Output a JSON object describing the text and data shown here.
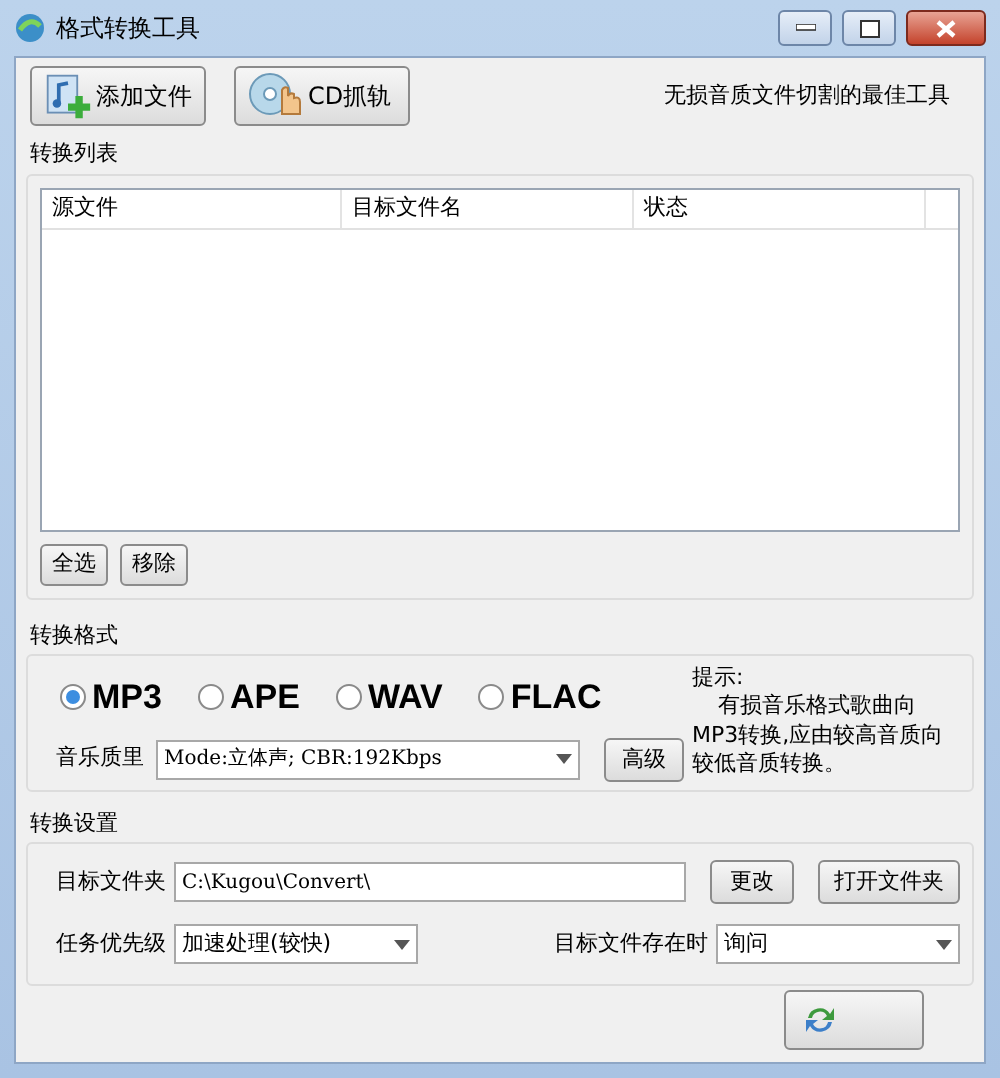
{
  "window": {
    "title": "格式转换工具"
  },
  "toolbar": {
    "buttons": [
      "添加文件",
      "CD抓轨"
    ],
    "slogan": "无损音质文件切割的最佳工具"
  },
  "list_group": {
    "title": "转换列表",
    "columns": [
      "源文件",
      "目标文件名",
      "状态"
    ],
    "buttons": [
      "全选",
      "移除"
    ]
  },
  "format_group": {
    "title": "转换格式",
    "formats": [
      {
        "label": "MP3",
        "selected": true
      },
      {
        "label": "APE",
        "selected": false
      },
      {
        "label": "WAV",
        "selected": false
      },
      {
        "label": "FLAC",
        "selected": false
      }
    ],
    "quality_label": "音乐质里",
    "quality_value": "Mode:立体声; CBR:192Kbps",
    "advanced_button": "高级",
    "hint_title": "提示:",
    "hint_text": "有损音乐格式歌曲向MP3转换,应由较高音质向较低音质转换。"
  },
  "settings_group": {
    "title": "转换设置",
    "folder_label": "目标文件夹",
    "folder_value": "C:\\Kugou\\Convert\\",
    "change_button": "更改",
    "open_button": "打开文件夹",
    "priority_label": "任务优先级",
    "priority_value": "加速处理(较快)",
    "exists_label": "目标文件存在时",
    "exists_value": "询问"
  }
}
